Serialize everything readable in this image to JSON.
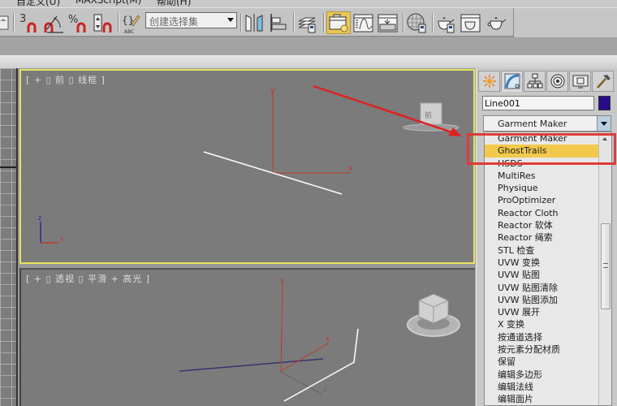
{
  "menubar": {
    "items": [
      "自定义(U)",
      "MAXScript(M)",
      "帮助(H)"
    ]
  },
  "toolbar": {
    "snap_3d_label": "3",
    "angle_snap_label": "angle-snap",
    "percent_snap_label": "%",
    "spinner_snap_label": "spinner-snap",
    "named_selection_set": {
      "placeholder": "创建选择集",
      "value": "创建选择集"
    },
    "buttons": [
      "mirror",
      "align",
      "layer-manager",
      "scene-explorer",
      "curve-editor",
      "schematic-view",
      "material-editor",
      "render-setup",
      "rendered-frame-window",
      "render"
    ]
  },
  "viewports": {
    "front": {
      "label": "[ + ▯ 前 ▯ 线框 ]",
      "gizmo_axes": {
        "y": "y",
        "x": "x"
      },
      "corner_axes": {
        "z": "z",
        "x": "x"
      },
      "active": true
    },
    "perspective": {
      "label": "[ + ▯ 透视 ▯ 平滑 + 高光 ]",
      "gizmo_axes": {
        "y": "y",
        "x": "x",
        "z": "z"
      }
    }
  },
  "command_panel": {
    "tabs": [
      "create",
      "modify",
      "hierarchy",
      "motion",
      "display",
      "utilities"
    ],
    "active_tab": "modify",
    "object_name": "Line001",
    "object_color": "#2a0a8c",
    "modifier_list_value": "Garment Maker",
    "modifier_list_items": [
      "Garment Maker",
      "GhostTrails",
      "HSDS",
      "MultiRes",
      "Physique",
      "ProOptimizer",
      "Reactor Cloth",
      "Reactor 软体",
      "Reactor 绳索",
      "STL 检查",
      "UVW 变换",
      "UVW 贴图",
      "UVW 贴图清除",
      "UVW 贴图添加",
      "UVW 展开",
      "X 变换",
      "按通道选择",
      "按元素分配材质",
      "保留",
      "编辑多边形",
      "编辑法线",
      "编辑面片"
    ],
    "selected_item": "GhostTrails"
  },
  "annotation": {
    "arrow_color": "#e02020",
    "box_color": "#e03a3a"
  }
}
